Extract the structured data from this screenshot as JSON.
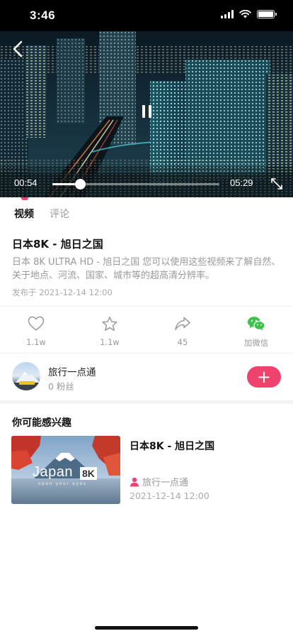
{
  "status_bar": {
    "time": "3:46"
  },
  "player": {
    "current_time": "00:54",
    "total_time": "05:29",
    "progress": 0.164
  },
  "tabs": [
    {
      "label": "视频",
      "active": true
    },
    {
      "label": "评论",
      "active": false
    }
  ],
  "video": {
    "title": "日本8K - 旭日之国",
    "description": "日本 8K ULTRA HD - 旭日之国  您可以使用这些视频来了解自然、关于地点、河流、国家、城市等的超高清分辨率。",
    "publish_prefix": "发布于",
    "publish_time": "2021-12-14 12:00"
  },
  "actions": [
    {
      "icon": "heart-icon",
      "label": "1.1w"
    },
    {
      "icon": "star-icon",
      "label": "1.1w"
    },
    {
      "icon": "share-icon",
      "label": "45"
    },
    {
      "icon": "wechat-icon",
      "label": "加微信"
    }
  ],
  "author": {
    "name": "旅行一点通",
    "fans": "0 粉丝",
    "follow_label": "+"
  },
  "recommend": {
    "heading": "你可能感兴趣",
    "items": [
      {
        "title": "日本8K - 旭日之国",
        "author": "旅行一点通",
        "date": "2021-12-14 12:00",
        "thumb_text": "Japan",
        "thumb_badge": "8K",
        "thumb_sub": "open your eyes"
      }
    ]
  },
  "colors": {
    "accent": "#f0426e",
    "wechat": "#3cc34b",
    "muted": "#999999"
  }
}
